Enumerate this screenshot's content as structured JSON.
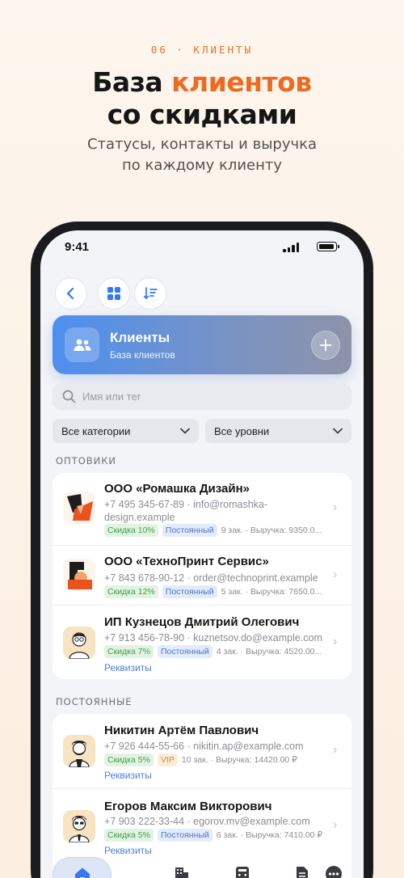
{
  "promo": {
    "kicker": "06 · КЛИЕНТЫ",
    "title_part1": "База ",
    "title_accent": "клиентов",
    "title_line2": "со скидками",
    "subtitle_line1": "Статусы, контакты и выручка",
    "subtitle_line2": "по каждому клиенту"
  },
  "status_bar": {
    "time": "9:41"
  },
  "toolbar": {
    "back_icon": "chevron-left-icon",
    "grid_icon": "grid-icon",
    "sort_icon": "sort-icon"
  },
  "hero": {
    "title": "Клиенты",
    "subtitle": "База клиентов",
    "icon": "users-icon",
    "add_icon": "plus-icon"
  },
  "search": {
    "placeholder": "Имя или тег",
    "value": ""
  },
  "filters": {
    "category": "Все категории",
    "level": "Все уровни"
  },
  "sections": [
    {
      "label": "ОПТОВИКИ",
      "clients": [
        {
          "name": "ООО «Ромашка Дизайн»",
          "contact": "+7 495 345-67-89 · info@romashka-design.example",
          "discount": "Скидка 10%",
          "status": "Постоянный",
          "meta": "9 зак. · Выручка: 9350.0..."
        },
        {
          "name": "ООО «ТехноПринт Сервис»",
          "contact": "+7 843 678-90-12 · order@technoprint.example",
          "discount": "Скидка 12%",
          "status": "Постоянный",
          "meta": "5 зак. · Выручка: 7650.0..."
        },
        {
          "name": "ИП Кузнецов Дмитрий Олегович",
          "contact": "+7 913 456-78-90 · kuznetsov.do@example.com",
          "discount": "Скидка 7%",
          "status": "Постоянный",
          "meta": "4 зак. · Выручка: 4520.00...",
          "link": "Реквизиты"
        }
      ]
    },
    {
      "label": "ПОСТОЯННЫЕ",
      "clients": [
        {
          "name": "Никитин Артём Павлович",
          "contact": "+7 926 444-55-66 · nikitin.ap@example.com",
          "discount": "Скидка 5%",
          "status": "VIP",
          "meta": "10 зак. · Выручка: 14420.00 ₽",
          "link": "Реквизиты"
        },
        {
          "name": "Егоров Максим Викторович",
          "contact": "+7 903 222-33-44 · egorov.mv@example.com",
          "discount": "Скидка 5%",
          "status": "Постоянный",
          "meta": "6 зак. · Выручка: 7410.00 ₽",
          "link": "Реквизиты"
        }
      ]
    }
  ],
  "tabbar": {
    "items": [
      "home-icon",
      "building-icon",
      "calculator-icon",
      "document-icon",
      "more-icon"
    ]
  },
  "colors": {
    "accent": "#EE6A22",
    "link": "#4D7FE0",
    "hero_start": "#4D8FF0"
  }
}
